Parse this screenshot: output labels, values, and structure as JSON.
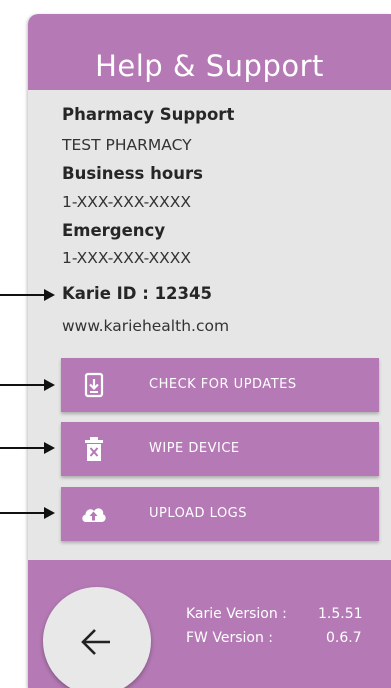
{
  "header": {
    "title": "Help & Support"
  },
  "info": {
    "pharmacy_label": "Pharmacy Support",
    "pharmacy_value": "TEST PHARMACY",
    "hours_label": "Business hours",
    "hours_value": "1-XXX-XXX-XXXX",
    "emergency_label": "Emergency",
    "emergency_value": "1-XXX-XXX-XXXX",
    "karie_id": "Karie ID : 12345",
    "website": "www.kariehealth.com"
  },
  "buttons": {
    "updates": "CHECK FOR UPDATES",
    "wipe": "WIPE DEVICE",
    "logs": "UPLOAD LOGS"
  },
  "footer": {
    "karie_version_label": "Karie Version :",
    "karie_version_value": "1.5.51",
    "fw_version_label": "FW Version :",
    "fw_version_value": "0.6.7"
  },
  "colors": {
    "accent": "#b57ab5",
    "panel_bg": "#e6e6e6",
    "text": "#262626"
  },
  "icons": [
    "download-phone-icon",
    "trash-icon",
    "cloud-upload-icon",
    "back-arrow-icon"
  ]
}
